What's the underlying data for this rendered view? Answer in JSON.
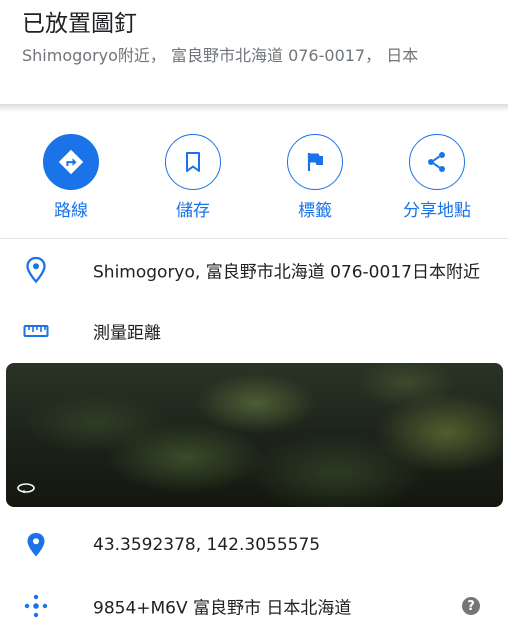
{
  "header": {
    "title": "已放置圖釘",
    "subtitle": "Shimogoryo附近， 富良野市北海道 076-0017， 日本"
  },
  "actions": [
    {
      "label": "路線",
      "icon": "directions-icon"
    },
    {
      "label": "儲存",
      "icon": "bookmark-icon"
    },
    {
      "label": "標籤",
      "icon": "flag-icon"
    },
    {
      "label": "分享地點",
      "icon": "share-icon"
    }
  ],
  "details": {
    "address": "Shimogoryo, 富良野市北海道 076-0017日本附近",
    "measure": "測量距離",
    "coordinates": "43.3592378, 142.3055575",
    "plus_code": "9854+M6V 富良野市 日本北海道",
    "help": "?"
  },
  "colors": {
    "accent": "#1a73e8",
    "text_primary": "#202124",
    "text_secondary": "#70757a"
  }
}
